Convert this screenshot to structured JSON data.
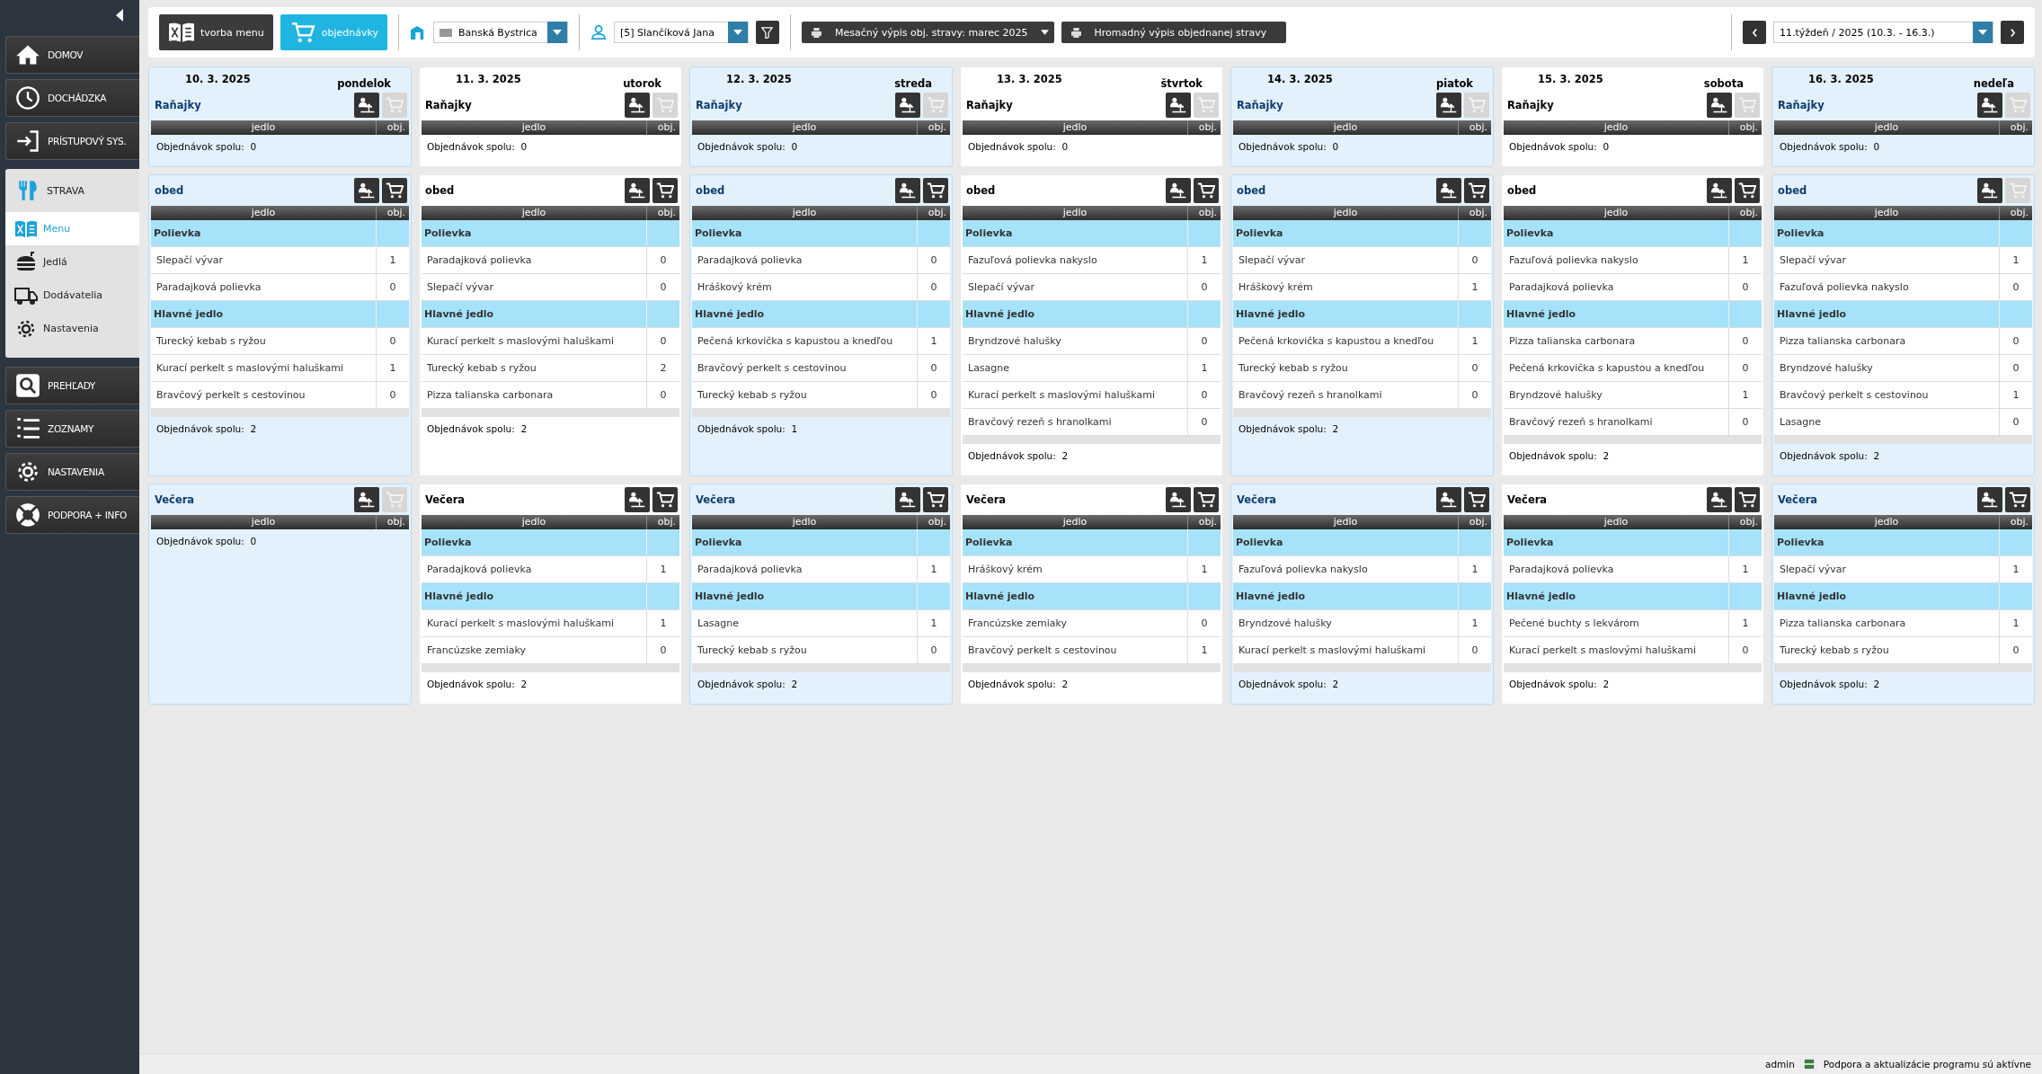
{
  "sidebar": {
    "items": [
      {
        "label": "DOMOV",
        "kind": "main"
      },
      {
        "label": "DOCHÁDZKA",
        "kind": "main"
      },
      {
        "label": "PRÍSTUPOVÝ SYS.",
        "kind": "main"
      },
      {
        "label": "STRAVA",
        "kind": "group",
        "children": [
          {
            "label": "Menu",
            "selected": true
          },
          {
            "label": "Jedlá",
            "selected": false
          },
          {
            "label": "Dodávatelia",
            "selected": false
          },
          {
            "label": "Nastavenia",
            "selected": false
          }
        ]
      },
      {
        "label": "PREHĽADY",
        "kind": "main"
      },
      {
        "label": "ZOZNAMY",
        "kind": "main"
      },
      {
        "label": "NASTAVENIA",
        "kind": "main"
      },
      {
        "label": "PODPORA + INFO",
        "kind": "main"
      }
    ]
  },
  "toolbar": {
    "tabs": [
      {
        "label": "tvorba menu",
        "selected": false
      },
      {
        "label": "objednávky",
        "selected": true
      }
    ],
    "location": {
      "value": "Banská Bystrica"
    },
    "person": {
      "value": "[5] Slančíková Jana"
    },
    "monthly_report": {
      "label": "Mesačný výpis obj. stravy: marec 2025"
    },
    "bulk_report": {
      "label": "Hromadný výpis objednanej stravy"
    },
    "week": {
      "value": "11.týždeň / 2025 (10.3. - 16.3.)"
    }
  },
  "days": [
    {
      "date": "10. 3. 2025",
      "weekday": "pondelok",
      "shaded": true,
      "meals": [
        {
          "title": "Raňajky",
          "cart_enabled": false,
          "columns": [
            "jedlo",
            "obj."
          ],
          "total_label": "Objednávok spolu:",
          "total": "0"
        },
        {
          "title": "obed",
          "cart_enabled": true,
          "columns": [
            "jedlo",
            "obj."
          ],
          "groups": [
            {
              "name": "Polievka",
              "items": [
                {
                  "name": "Slepačí vývar",
                  "count": "1"
                },
                {
                  "name": "Paradajková polievka",
                  "count": "0"
                }
              ]
            },
            {
              "name": "Hlavné jedlo",
              "items": [
                {
                  "name": "Turecký kebab s ryžou",
                  "count": "0"
                },
                {
                  "name": "Kurací perkelt s maslovými haluškami",
                  "count": "1"
                },
                {
                  "name": "Bravčový perkelt s cestovinou",
                  "count": "0"
                }
              ]
            }
          ],
          "total_label": "Objednávok spolu:",
          "total": "2"
        },
        {
          "title": "Večera",
          "cart_enabled": false,
          "columns": [
            "jedlo",
            "obj."
          ],
          "total_label": "Objednávok spolu:",
          "total": "0"
        }
      ]
    },
    {
      "date": "11. 3. 2025",
      "weekday": "utorok",
      "shaded": false,
      "meals": [
        {
          "title": "Raňajky",
          "cart_enabled": false,
          "columns": [
            "jedlo",
            "obj."
          ],
          "total_label": "Objednávok spolu:",
          "total": "0"
        },
        {
          "title": "obed",
          "cart_enabled": true,
          "columns": [
            "jedlo",
            "obj."
          ],
          "groups": [
            {
              "name": "Polievka",
              "items": [
                {
                  "name": "Paradajková polievka",
                  "count": "0"
                },
                {
                  "name": "Slepačí vývar",
                  "count": "0"
                }
              ]
            },
            {
              "name": "Hlavné jedlo",
              "items": [
                {
                  "name": "Kurací perkelt s maslovými haluškami",
                  "count": "0"
                },
                {
                  "name": "Turecký kebab s ryžou",
                  "count": "2"
                },
                {
                  "name": "Pizza talianska carbonara",
                  "count": "0"
                }
              ]
            }
          ],
          "total_label": "Objednávok spolu:",
          "total": "2"
        },
        {
          "title": "Večera",
          "cart_enabled": true,
          "columns": [
            "jedlo",
            "obj."
          ],
          "groups": [
            {
              "name": "Polievka",
              "items": [
                {
                  "name": "Paradajková polievka",
                  "count": "1"
                }
              ]
            },
            {
              "name": "Hlavné jedlo",
              "items": [
                {
                  "name": "Kurací perkelt s maslovými haluškami",
                  "count": "1"
                },
                {
                  "name": "Francúzske zemiaky",
                  "count": "0"
                }
              ]
            }
          ],
          "total_label": "Objednávok spolu:",
          "total": "2"
        }
      ]
    },
    {
      "date": "12. 3. 2025",
      "weekday": "streda",
      "shaded": true,
      "meals": [
        {
          "title": "Raňajky",
          "cart_enabled": false,
          "columns": [
            "jedlo",
            "obj."
          ],
          "total_label": "Objednávok spolu:",
          "total": "0"
        },
        {
          "title": "obed",
          "cart_enabled": true,
          "columns": [
            "jedlo",
            "obj."
          ],
          "groups": [
            {
              "name": "Polievka",
              "items": [
                {
                  "name": "Paradajková polievka",
                  "count": "0"
                },
                {
                  "name": "Hráškový krém",
                  "count": "0"
                }
              ]
            },
            {
              "name": "Hlavné jedlo",
              "items": [
                {
                  "name": "Pečená krkovička s kapustou a knedľou",
                  "count": "1"
                },
                {
                  "name": "Bravčový perkelt s cestovinou",
                  "count": "0"
                },
                {
                  "name": "Turecký kebab s ryžou",
                  "count": "0"
                }
              ]
            }
          ],
          "total_label": "Objednávok spolu:",
          "total": "1"
        },
        {
          "title": "Večera",
          "cart_enabled": true,
          "columns": [
            "jedlo",
            "obj."
          ],
          "groups": [
            {
              "name": "Polievka",
              "items": [
                {
                  "name": "Paradajková polievka",
                  "count": "1"
                }
              ]
            },
            {
              "name": "Hlavné jedlo",
              "items": [
                {
                  "name": "Lasagne",
                  "count": "1"
                },
                {
                  "name": "Turecký kebab s ryžou",
                  "count": "0"
                }
              ]
            }
          ],
          "total_label": "Objednávok spolu:",
          "total": "2"
        }
      ]
    },
    {
      "date": "13. 3. 2025",
      "weekday": "štvrtok",
      "shaded": false,
      "meals": [
        {
          "title": "Raňajky",
          "cart_enabled": false,
          "columns": [
            "jedlo",
            "obj."
          ],
          "total_label": "Objednávok spolu:",
          "total": "0"
        },
        {
          "title": "obed",
          "cart_enabled": true,
          "columns": [
            "jedlo",
            "obj."
          ],
          "groups": [
            {
              "name": "Polievka",
              "items": [
                {
                  "name": "Fazuľová polievka nakyslo",
                  "count": "1"
                },
                {
                  "name": "Slepačí vývar",
                  "count": "0"
                }
              ]
            },
            {
              "name": "Hlavné jedlo",
              "items": [
                {
                  "name": "Bryndzové halušky",
                  "count": "0"
                },
                {
                  "name": "Lasagne",
                  "count": "1"
                },
                {
                  "name": "Kurací perkelt s maslovými haluškami",
                  "count": "0"
                },
                {
                  "name": "Bravčový rezeň s hranolkami",
                  "count": "0"
                }
              ]
            }
          ],
          "total_label": "Objednávok spolu:",
          "total": "2"
        },
        {
          "title": "Večera",
          "cart_enabled": true,
          "columns": [
            "jedlo",
            "obj."
          ],
          "groups": [
            {
              "name": "Polievka",
              "items": [
                {
                  "name": "Hráškový krém",
                  "count": "1"
                }
              ]
            },
            {
              "name": "Hlavné jedlo",
              "items": [
                {
                  "name": "Francúzske zemiaky",
                  "count": "0"
                },
                {
                  "name": "Bravčový perkelt s cestovinou",
                  "count": "1"
                }
              ]
            }
          ],
          "total_label": "Objednávok spolu:",
          "total": "2"
        }
      ]
    },
    {
      "date": "14. 3. 2025",
      "weekday": "piatok",
      "shaded": true,
      "meals": [
        {
          "title": "Raňajky",
          "cart_enabled": false,
          "columns": [
            "jedlo",
            "obj."
          ],
          "total_label": "Objednávok spolu:",
          "total": "0"
        },
        {
          "title": "obed",
          "cart_enabled": true,
          "columns": [
            "jedlo",
            "obj."
          ],
          "groups": [
            {
              "name": "Polievka",
              "items": [
                {
                  "name": "Slepačí vývar",
                  "count": "0"
                },
                {
                  "name": "Hráškový krém",
                  "count": "1"
                }
              ]
            },
            {
              "name": "Hlavné jedlo",
              "items": [
                {
                  "name": "Pečená krkovička s kapustou a knedľou",
                  "count": "1"
                },
                {
                  "name": "Turecký kebab s ryžou",
                  "count": "0"
                },
                {
                  "name": "Bravčový rezeň s hranolkami",
                  "count": "0"
                }
              ]
            }
          ],
          "total_label": "Objednávok spolu:",
          "total": "2"
        },
        {
          "title": "Večera",
          "cart_enabled": true,
          "columns": [
            "jedlo",
            "obj."
          ],
          "groups": [
            {
              "name": "Polievka",
              "items": [
                {
                  "name": "Fazuľová polievka nakyslo",
                  "count": "1"
                }
              ]
            },
            {
              "name": "Hlavné jedlo",
              "items": [
                {
                  "name": "Bryndzové halušky",
                  "count": "1"
                },
                {
                  "name": "Kurací perkelt s maslovými haluškami",
                  "count": "0"
                }
              ]
            }
          ],
          "total_label": "Objednávok spolu:",
          "total": "2"
        }
      ]
    },
    {
      "date": "15. 3. 2025",
      "weekday": "sobota",
      "shaded": false,
      "meals": [
        {
          "title": "Raňajky",
          "cart_enabled": false,
          "columns": [
            "jedlo",
            "obj."
          ],
          "total_label": "Objednávok spolu:",
          "total": "0"
        },
        {
          "title": "obed",
          "cart_enabled": true,
          "columns": [
            "jedlo",
            "obj."
          ],
          "groups": [
            {
              "name": "Polievka",
              "items": [
                {
                  "name": "Fazuľová polievka nakyslo",
                  "count": "1"
                },
                {
                  "name": "Paradajková polievka",
                  "count": "0"
                }
              ]
            },
            {
              "name": "Hlavné jedlo",
              "items": [
                {
                  "name": "Pizza talianska carbonara",
                  "count": "0"
                },
                {
                  "name": "Pečená krkovička s kapustou a knedľou",
                  "count": "0"
                },
                {
                  "name": "Bryndzové halušky",
                  "count": "1"
                },
                {
                  "name": "Bravčový rezeň s hranolkami",
                  "count": "0"
                }
              ]
            }
          ],
          "total_label": "Objednávok spolu:",
          "total": "2"
        },
        {
          "title": "Večera",
          "cart_enabled": true,
          "columns": [
            "jedlo",
            "obj."
          ],
          "groups": [
            {
              "name": "Polievka",
              "items": [
                {
                  "name": "Paradajková polievka",
                  "count": "1"
                }
              ]
            },
            {
              "name": "Hlavné jedlo",
              "items": [
                {
                  "name": "Pečené buchty s lekvárom",
                  "count": "1"
                },
                {
                  "name": "Kurací perkelt s maslovými haluškami",
                  "count": "0"
                }
              ]
            }
          ],
          "total_label": "Objednávok spolu:",
          "total": "2"
        }
      ]
    },
    {
      "date": "16. 3. 2025",
      "weekday": "nedeľa",
      "shaded": true,
      "meals": [
        {
          "title": "Raňajky",
          "cart_enabled": false,
          "columns": [
            "jedlo",
            "obj."
          ],
          "total_label": "Objednávok spolu:",
          "total": "0"
        },
        {
          "title": "obed",
          "cart_enabled": false,
          "columns": [
            "jedlo",
            "obj."
          ],
          "groups": [
            {
              "name": "Polievka",
              "items": [
                {
                  "name": "Slepačí vývar",
                  "count": "1"
                },
                {
                  "name": "Fazuľová polievka nakyslo",
                  "count": "0"
                }
              ]
            },
            {
              "name": "Hlavné jedlo",
              "items": [
                {
                  "name": "Pizza talianska carbonara",
                  "count": "0"
                },
                {
                  "name": "Bryndzové halušky",
                  "count": "0"
                },
                {
                  "name": "Bravčový perkelt s cestovinou",
                  "count": "1"
                },
                {
                  "name": "Lasagne",
                  "count": "0"
                }
              ]
            }
          ],
          "total_label": "Objednávok spolu:",
          "total": "2"
        },
        {
          "title": "Večera",
          "cart_enabled": true,
          "columns": [
            "jedlo",
            "obj."
          ],
          "groups": [
            {
              "name": "Polievka",
              "items": [
                {
                  "name": "Slepačí vývar",
                  "count": "1"
                }
              ]
            },
            {
              "name": "Hlavné jedlo",
              "items": [
                {
                  "name": "Pizza talianska carbonara",
                  "count": "1"
                },
                {
                  "name": "Turecký kebab s ryžou",
                  "count": "0"
                }
              ]
            }
          ],
          "total_label": "Objednávok spolu:",
          "total": "2"
        }
      ]
    }
  ],
  "status_bar": {
    "user": "admin",
    "message": "Podpora a aktualizácie programu sú aktívne"
  }
}
